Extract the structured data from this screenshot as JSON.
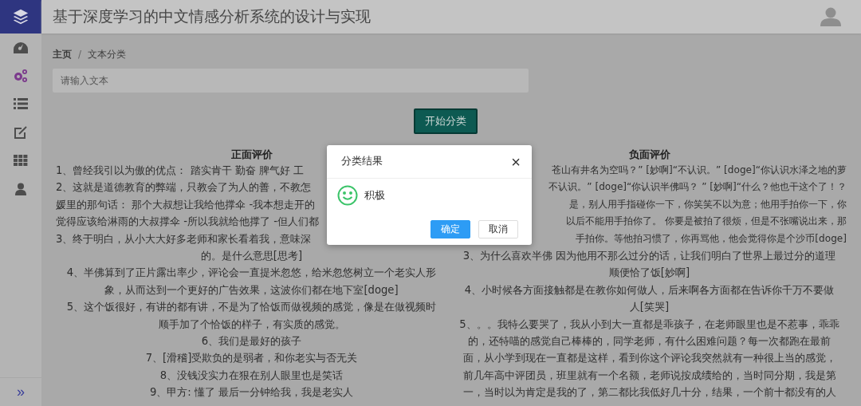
{
  "header": {
    "title": "基于深度学习的中文情感分析系统的设计与实现"
  },
  "sidebar": {
    "items": [
      {
        "selected": false
      },
      {
        "selected": true
      },
      {
        "selected": false
      },
      {
        "selected": false
      },
      {
        "selected": false
      },
      {
        "selected": false
      }
    ],
    "collapse": "»"
  },
  "breadcrumb": [
    "主页",
    "/",
    "文本分类"
  ],
  "input": {
    "placeholder": "请输入文本"
  },
  "classify_button": "开始分类",
  "columns": [
    {
      "heading": "正面评价",
      "lines": [
        {
          "kind": "cut_right",
          "text": "1、曾经我引以为傲的优点： 踏实肯干 勤奋 脾气好 工"
        },
        {
          "kind": "cut_right",
          "text": "2、这就是道德教育的弊端，只教会了为人的善，不教怎"
        },
        {
          "kind": "cut_right",
          "text": "媛里的那句话： 那个大叔想让我给他撑伞 -我本想走开的"
        },
        {
          "kind": "cut_right",
          "text": "觉得应该给淋雨的大叔撑伞 -所以我就给他撑了 -但人们都"
        },
        {
          "kind": "cut_right",
          "text": "3、终于明白，从小大大好多老师和家长看着我，意味深"
        },
        {
          "kind": "full",
          "text": "的。是什么意思[思考]"
        },
        {
          "kind": "full",
          "text": "4、半佛算到了正片露出率少，评论会一直提米忽悠，给米忽悠树立一个老实人形"
        },
        {
          "kind": "full",
          "text": "象，从而达到一个更好的广告效果，这波你们都在地下室[doge]"
        },
        {
          "kind": "full",
          "text": "5、这个饭很好，有讲的都有讲，不是为了恰饭而做视频的感觉，像是在做视频时"
        },
        {
          "kind": "full",
          "text": "顺手加了个恰饭的样子，有实质的感觉。"
        },
        {
          "kind": "full",
          "text": "6、我们是最好的孩子"
        },
        {
          "kind": "full",
          "text": "7、[滑稽]受欺负的是弱者，和你老实与否无关"
        },
        {
          "kind": "full",
          "text": "8、没钱没实力在狠在别人眼里也是笑话"
        },
        {
          "kind": "full",
          "text": "9、甲方: 懂了 最后一分钟给我，我是老实人"
        }
      ]
    },
    {
      "heading": "负面评价",
      "lines": [
        {
          "kind": "cut_left",
          "text": "苍山有井名为空吗？” [妙啊]“不认识。” [doge]“你认识水泽之地的萝"
        },
        {
          "kind": "cut_left",
          "text": "不认识。” [doge]“你认识半佛吗？ ” [妙啊]“什么？他也干这个了！？"
        },
        {
          "kind": "cut_left",
          "text": "是，别人用手指碰你一下，你笑笑不以为意；他用手拍你一下，你"
        },
        {
          "kind": "cut_left",
          "text": "以后不能用手拍你了。 你要是被拍了很烦，但是不张嘴说出来，那"
        },
        {
          "kind": "cut_left",
          "text": "手拍你。等他拍习惯了，你再骂他，他会觉得你是个沙币[doge]"
        },
        {
          "kind": "full",
          "text": "3、为什么喜欢半佛 因为他用不那么过分的话，让我们明白了世界上最过分的道理"
        },
        {
          "kind": "full",
          "text": "顺便恰了饭[妙啊]"
        },
        {
          "kind": "full",
          "text": "4、小时候各方面接触都是在教你如何做人，后来啊各方面都在告诉你千万不要做"
        },
        {
          "kind": "full",
          "text": "人[笑哭]"
        },
        {
          "kind": "full",
          "text": "5、。。我特么要哭了，我从小到大一直都是乖孩子，在老师眼里也是不惹事，乖乖"
        },
        {
          "kind": "full",
          "text": "的，还特喵的感觉自己棒棒的，同学老师，有什么困难问题？每一次都跑在最前"
        },
        {
          "kind": "full",
          "text": "面，从小学到现在一直都是这样，看到你这个评论我突然就有一种很上当的感觉，"
        },
        {
          "kind": "full",
          "text": "前几年高中评团员，班里就有一个名额，老师说按成绩给的，当时同分期，我是第"
        },
        {
          "kind": "full",
          "text": "一，当时以为肯定是我的了，第二都比我低好几十分，结果，一个前十都没有的人"
        }
      ]
    }
  ],
  "dialog": {
    "title": "分类结果",
    "close": "×",
    "result": "积极",
    "buttons": [
      {
        "label": "确定",
        "kind": "primary"
      },
      {
        "label": "取消",
        "kind": "default"
      }
    ]
  }
}
